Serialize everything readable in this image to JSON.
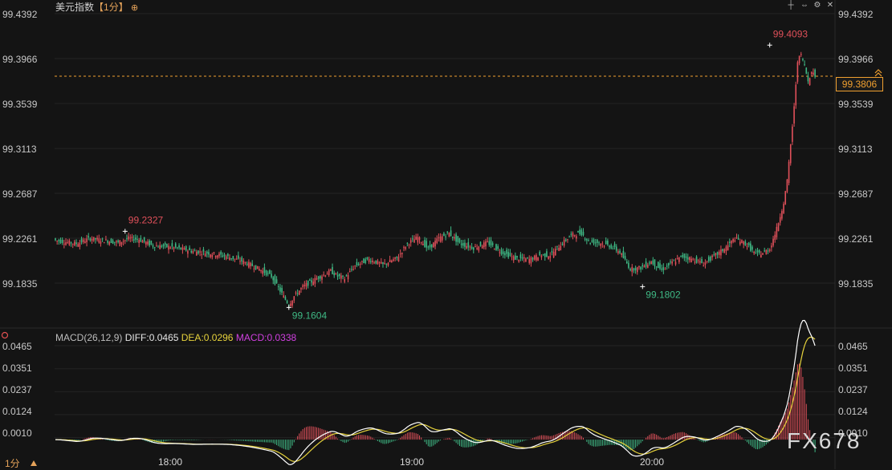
{
  "header": {
    "instrument": "美元指数",
    "period": "【1分】",
    "toolbar_icons": [
      "crosshair-icon",
      "expand-icon",
      "settings-icon",
      "close-icon"
    ]
  },
  "chart_data": [
    {
      "type": "candlestick",
      "instrument": "美元指数",
      "ylim": [
        99.1409,
        99.4392
      ],
      "yticks": [
        "99.4392",
        "99.3966",
        "99.3539",
        "99.3113",
        "99.2687",
        "99.2261",
        "99.1835"
      ],
      "xticks": [
        "18:00",
        "19:00",
        "20:00"
      ],
      "current_price": 99.3806,
      "current_price_label": "99.3806",
      "annotations": [
        {
          "label": "99.2327",
          "value": 99.2327,
          "kind": "local-high"
        },
        {
          "label": "99.1604",
          "value": 99.1604,
          "kind": "local-low"
        },
        {
          "label": "99.1802",
          "value": 99.1802,
          "kind": "local-low"
        },
        {
          "label": "99.4093",
          "value": 99.4093,
          "kind": "high"
        }
      ],
      "up_color": "#e0505a",
      "down_color": "#3fb985",
      "close_path": [
        [
          0,
          99.224
        ],
        [
          12,
          99.221
        ],
        [
          20,
          99.226
        ],
        [
          28,
          99.224
        ],
        [
          36,
          99.222
        ],
        [
          42,
          99.226
        ],
        [
          48,
          99.225
        ],
        [
          56,
          99.219
        ],
        [
          66,
          99.218
        ],
        [
          78,
          99.214
        ],
        [
          88,
          99.212
        ],
        [
          98,
          99.209
        ],
        [
          106,
          99.205
        ],
        [
          112,
          99.201
        ],
        [
          118,
          99.196
        ],
        [
          124,
          99.19
        ],
        [
          128,
          99.179
        ],
        [
          132,
          99.168
        ],
        [
          134,
          99.163
        ],
        [
          137,
          99.171
        ],
        [
          142,
          99.18
        ],
        [
          150,
          99.188
        ],
        [
          158,
          99.195
        ],
        [
          162,
          99.19
        ],
        [
          166,
          99.188
        ],
        [
          172,
          99.2
        ],
        [
          180,
          99.206
        ],
        [
          188,
          99.201
        ],
        [
          196,
          99.207
        ],
        [
          202,
          99.221
        ],
        [
          208,
          99.227
        ],
        [
          214,
          99.216
        ],
        [
          220,
          99.226
        ],
        [
          226,
          99.231
        ],
        [
          232,
          99.221
        ],
        [
          240,
          99.217
        ],
        [
          248,
          99.222
        ],
        [
          256,
          99.213
        ],
        [
          264,
          99.207
        ],
        [
          272,
          99.206
        ],
        [
          278,
          99.21
        ],
        [
          284,
          99.21
        ],
        [
          290,
          99.22
        ],
        [
          296,
          99.229
        ],
        [
          302,
          99.231
        ],
        [
          306,
          99.223
        ],
        [
          312,
          99.222
        ],
        [
          318,
          99.219
        ],
        [
          324,
          99.213
        ],
        [
          330,
          99.197
        ],
        [
          336,
          99.198
        ],
        [
          342,
          99.204
        ],
        [
          348,
          99.196
        ],
        [
          354,
          99.203
        ],
        [
          360,
          99.209
        ],
        [
          366,
          99.206
        ],
        [
          372,
          99.202
        ],
        [
          378,
          99.209
        ],
        [
          384,
          99.216
        ],
        [
          390,
          99.226
        ],
        [
          396,
          99.221
        ],
        [
          402,
          99.211
        ],
        [
          406,
          99.212
        ],
        [
          410,
          99.216
        ],
        [
          414,
          99.235
        ],
        [
          418,
          99.26
        ],
        [
          420,
          99.28
        ],
        [
          424,
          99.35
        ],
        [
          426,
          99.395
        ],
        [
          428,
          99.4
        ],
        [
          430,
          99.39
        ],
        [
          432,
          99.375
        ],
        [
          434,
          99.385
        ],
        [
          436,
          99.38
        ]
      ]
    },
    {
      "type": "macd",
      "indicator_label": "MACD(26,12,9)",
      "diff_label": "DIFF:0.0465",
      "dea_label": "DEA:0.0296",
      "macd_label": "MACD:0.0338",
      "diff": 0.0465,
      "dea": 0.0296,
      "macd": 0.0338,
      "ylim": [
        -0.0075,
        0.0465
      ],
      "yticks": [
        "0.0465",
        "0.0351",
        "0.0237",
        "0.0124",
        "0.0010"
      ],
      "diff_color": "#ffffff",
      "dea_color": "#e6d23c",
      "macd_color": "#d040e0"
    }
  ],
  "footer": {
    "period_label": "1分",
    "watermark": "FX678"
  }
}
